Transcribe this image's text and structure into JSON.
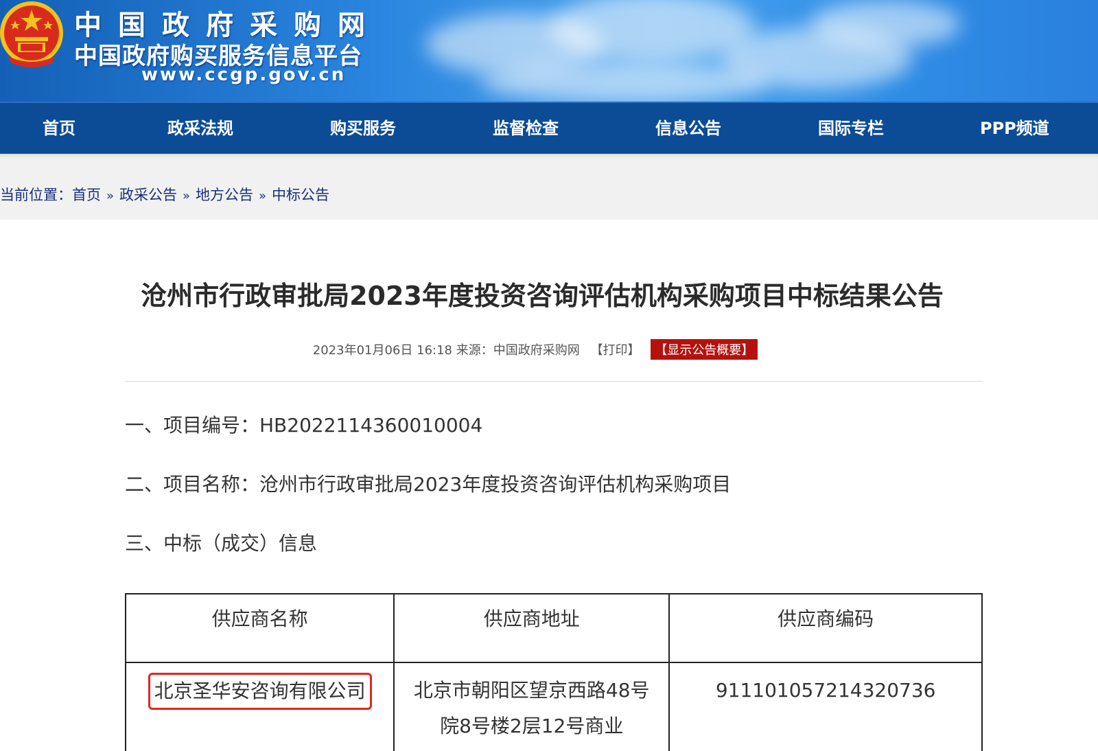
{
  "header": {
    "logo_line1": "中国政府采购网",
    "logo_line2": "中国政府购买服务信息平台",
    "logo_url": "www.ccgp.gov.cn",
    "emblem_icon": "national-emblem-icon"
  },
  "nav": {
    "items": [
      {
        "label": "首页"
      },
      {
        "label": "政采法规"
      },
      {
        "label": "购买服务"
      },
      {
        "label": "监督检查"
      },
      {
        "label": "信息公告"
      },
      {
        "label": "国际专栏"
      },
      {
        "label": "PPP频道"
      }
    ]
  },
  "breadcrumb": {
    "prefix": "当前位置：",
    "items": [
      {
        "label": "首页"
      },
      {
        "label": "政采公告"
      },
      {
        "label": "地方公告"
      },
      {
        "label": "中标公告"
      }
    ],
    "separator": "»"
  },
  "article": {
    "title": "沧州市行政审批局2023年度投资咨询评估机构采购项目中标结果公告",
    "date": "2023年01月06日 16:18",
    "source": "来源：中国政府采购网",
    "print_label": "【打印】",
    "summary_label": "【显示公告概要】",
    "sections": {
      "project_number": "一、项目编号：HB2022114360010004",
      "project_name": "二、项目名称：沧州市行政审批局2023年度投资咨询评估机构采购项目",
      "winner_info": "三、中标（成交）信息"
    },
    "table": {
      "headers": [
        "供应商名称",
        "供应商地址",
        "供应商编码"
      ],
      "rows": [
        {
          "name": "北京圣华安咨询有限公司",
          "address_line1": "北京市朝阳区望京西路48号",
          "address_line2": "院8号楼2层12号商业",
          "code": "911101057214320736"
        }
      ]
    }
  },
  "colors": {
    "banner_blue": "#2a86e0",
    "nav_blue": "#0c4c97",
    "summary_red": "#b5120e",
    "highlight_red": "#e0271f"
  }
}
